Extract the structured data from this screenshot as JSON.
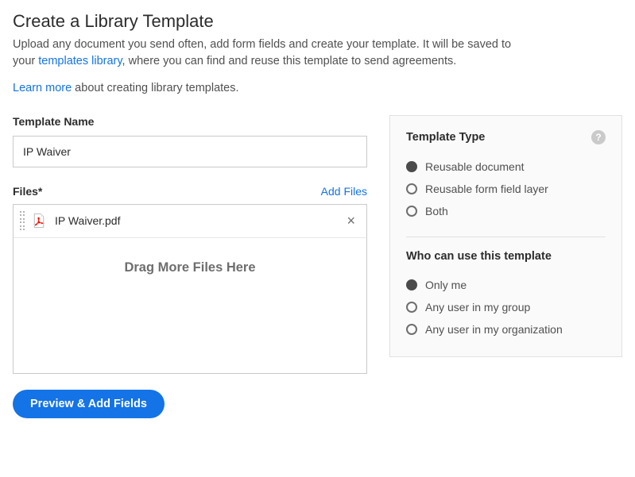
{
  "heading": "Create a Library Template",
  "intro_pre": "Upload any document you send often, add form fields and create your template. It will be saved to your ",
  "intro_link": "templates library",
  "intro_post": ", where you can find and reuse this template to send agreements.",
  "learn_link": "Learn more",
  "learn_post": " about creating library templates.",
  "templateName": {
    "label": "Template Name",
    "value": "IP Waiver"
  },
  "files": {
    "label": "Files",
    "required": "*",
    "addFiles": "Add Files",
    "items": [
      {
        "name": "IP Waiver.pdf"
      }
    ],
    "dropText": "Drag More Files Here"
  },
  "templateType": {
    "title": "Template Type",
    "options": [
      {
        "label": "Reusable document",
        "selected": true
      },
      {
        "label": "Reusable form field layer",
        "selected": false
      },
      {
        "label": "Both",
        "selected": false
      }
    ]
  },
  "whoCanUse": {
    "title": "Who can use this template",
    "options": [
      {
        "label": "Only me",
        "selected": true
      },
      {
        "label": "Any user in my group",
        "selected": false
      },
      {
        "label": "Any user in my organization",
        "selected": false
      }
    ]
  },
  "submit": "Preview & Add Fields"
}
